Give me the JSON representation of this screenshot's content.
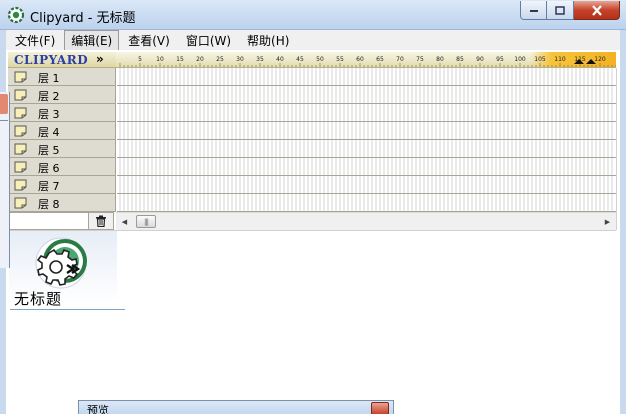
{
  "window": {
    "title": "Clipyard - 无标题",
    "icon": "clipyard-gear-icon"
  },
  "menu": [
    {
      "label": "文件(F)",
      "active": false
    },
    {
      "label": "编辑(E)",
      "active": true
    },
    {
      "label": "查看(V)",
      "active": false
    },
    {
      "label": "窗口(W)",
      "active": false
    },
    {
      "label": "帮助(H)",
      "active": false
    }
  ],
  "logo": {
    "text": "CLIPYARD",
    "suffix": "»",
    "color": "#2a3fa8"
  },
  "ruler": {
    "ticks": [
      "5",
      "10",
      "15",
      "20",
      "25",
      "30",
      "35",
      "40",
      "45",
      "50",
      "55",
      "60",
      "65",
      "70",
      "75",
      "80",
      "85",
      "90",
      "95",
      "100",
      "105",
      "110",
      "115",
      "120"
    ],
    "highlight_color": "#f2b222"
  },
  "layers": [
    {
      "label": "层 1"
    },
    {
      "label": "层 2"
    },
    {
      "label": "层 3"
    },
    {
      "label": "层 4"
    },
    {
      "label": "层 5"
    },
    {
      "label": "层 6"
    },
    {
      "label": "层 7"
    },
    {
      "label": "层 8"
    }
  ],
  "toolbar": {
    "trash_icon": "trash-icon"
  },
  "scrollbar": {
    "left_arrow": "◀",
    "right_arrow": "▶",
    "thumb_grip": "|||"
  },
  "document": {
    "name": "无标题",
    "icon": "document-gear-icon"
  },
  "preview_panel": {
    "title": "预览"
  },
  "colors": {
    "titlebar": "#bcd2ee",
    "close_button": "#c6432a",
    "layer_bg": "#dedbd0"
  }
}
